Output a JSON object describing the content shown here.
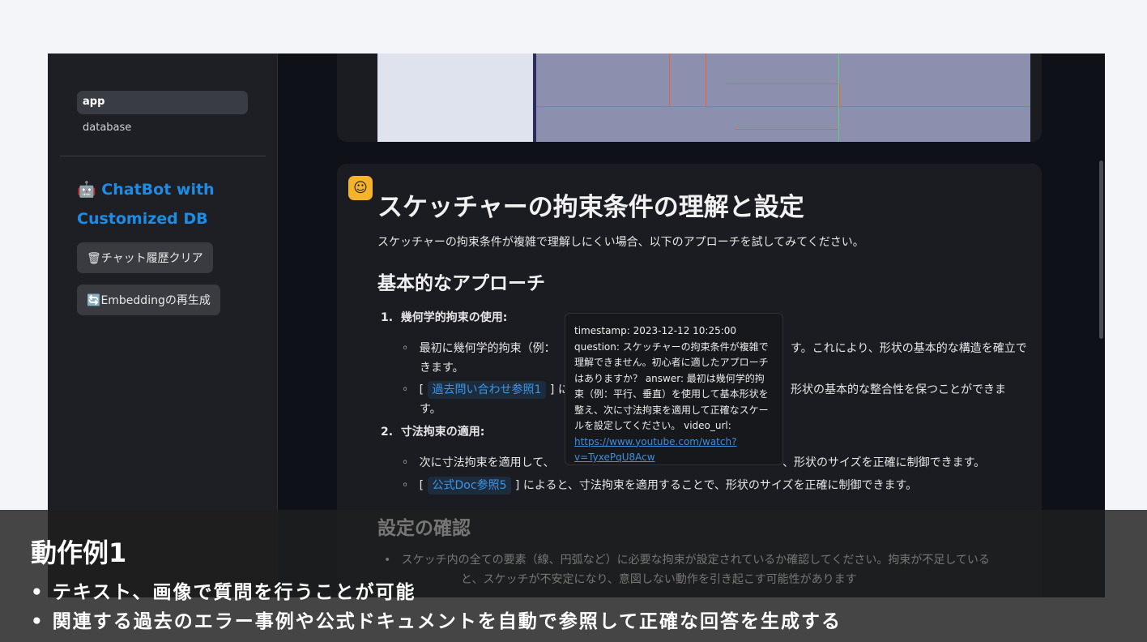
{
  "sidebar": {
    "nav": [
      "app",
      "database"
    ],
    "title": "ChatBot with Customized DB",
    "buttons": [
      "チャット履歴クリア",
      "Embeddingの再生成"
    ]
  },
  "message": {
    "title": "スケッチャーの拘束条件の理解と設定",
    "intro": "スケッチャーの拘束条件が複雑で理解しにくい場合、以下のアプローチを試してみてください。",
    "section1": "基本的なアプローチ",
    "item1": "幾何学的拘束の使用:",
    "item1_a1": "最初に幾何学的拘束（例：",
    "item1_a2": "す。これにより、形状の基本的な構造を確立で",
    "item1_a3": "きます。",
    "ref1": "過去問い合わせ参照1",
    "item1_b2": "形状の基本的な整合性を保つことができま",
    "item1_b3": "す。",
    "item2": "寸法拘束の適用:",
    "item2_a1": "次に寸法拘束を適用して、",
    "item2_a2": "、形状のサイズを正確に制御できます。",
    "ref2": "公式Doc参照5",
    "item2_b": "によると、寸法拘束を適用することで、形状のサイズを正確に制御できます。",
    "section2": "設定の確認",
    "bullet1": "スケッチ内の全ての要素（線、円弧など）に必要な拘束が設定されているか確認してください。拘束が不足している",
    "bullet1_cont": "と、スケッチが不安定になり、意図しない動作を引き起こす可能性があります"
  },
  "tooltip": {
    "text": "timestamp: 2023-12-12 10:25:00 question: スケッチャーの拘束条件が複雑で理解できません。初心者に適したアプローチはありますか？ answer: 最初は幾何学的拘束（例：平行、垂直）を使用して基本形状を整え、次に寸法拘束を適用して正確なスケールを設定してください。 video_url: ",
    "link": "https://www.youtube.com/watch?v=TyxePqU8Acw"
  },
  "caption": {
    "title": "動作例1",
    "lines": [
      "• テキスト、画像で質問を行うことが可能",
      "• 関連する過去のエラー事例や公式ドキュメントを自動で参照して正確な回答を生成する"
    ]
  }
}
